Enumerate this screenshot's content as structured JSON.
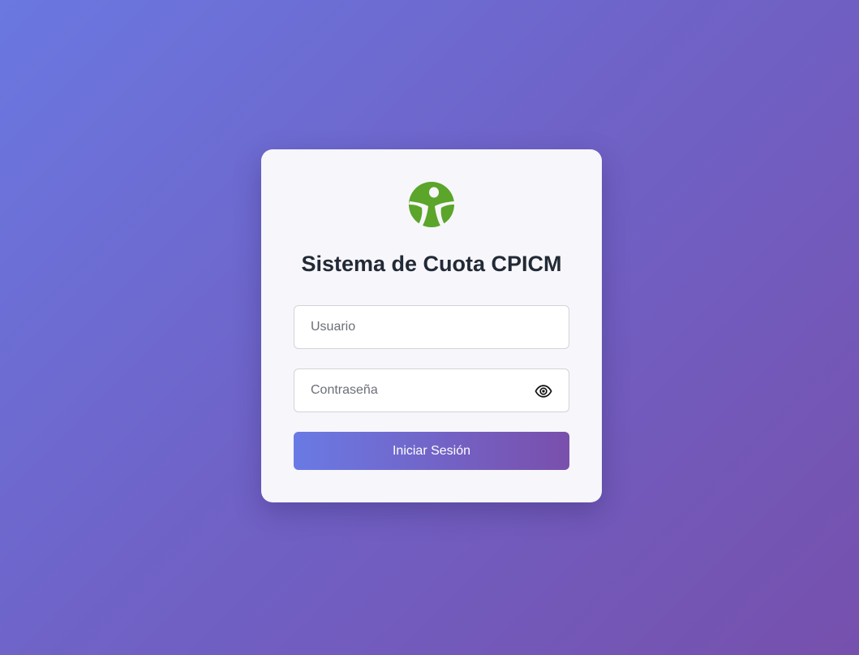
{
  "login": {
    "title": "Sistema de Cuota CPICM",
    "username": {
      "value": "",
      "placeholder": "Usuario"
    },
    "password": {
      "value": "",
      "placeholder": "Contraseña"
    },
    "toggle_icon": "eye-icon",
    "submit_label": "Iniciar Sesión"
  },
  "brand": {
    "logo_icon": "person-logo-icon",
    "logo_color": "#5aa52a",
    "background_gradient": [
      "#6a78e0",
      "#7650ad"
    ],
    "button_gradient": [
      "#6a7ae4",
      "#7a4fac"
    ]
  }
}
